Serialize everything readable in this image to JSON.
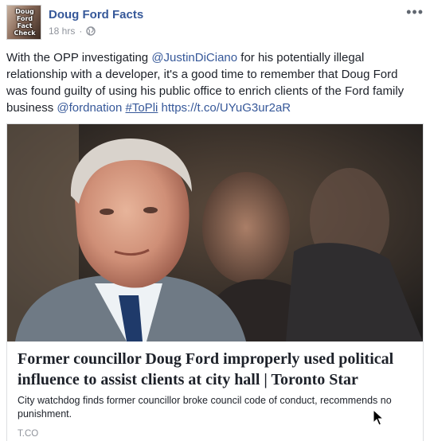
{
  "post": {
    "page_name": "Doug Ford Facts",
    "avatar_text": [
      "Doug",
      "Ford",
      "Fact",
      "Check"
    ],
    "timestamp": "18 hrs",
    "separator": "·",
    "privacy_icon": "globe-icon",
    "more_icon": "ellipsis-icon",
    "body": {
      "part1": "With the OPP investigating ",
      "mention1": "@JustinDiCiano",
      "part2": " for his potentially illegal relationship with a developer, it's a good time to remember that Doug Ford was found guilty of using his public office to enrich clients of the Ford family business ",
      "mention2": "@fordnation",
      "space": " ",
      "hashtag": "#ToPli",
      "link": "https://t.co/UYuG3ur2aR"
    }
  },
  "link_card": {
    "title": "Former councillor Doug Ford improperly used political influence to assist clients at city hall | Toronto Star",
    "description": "City watchdog finds former councillor broke council code of conduct, recommends no punishment.",
    "domain": "T.CO"
  },
  "colors": {
    "link": "#365899",
    "meta": "#90949c",
    "text": "#1d2129"
  }
}
